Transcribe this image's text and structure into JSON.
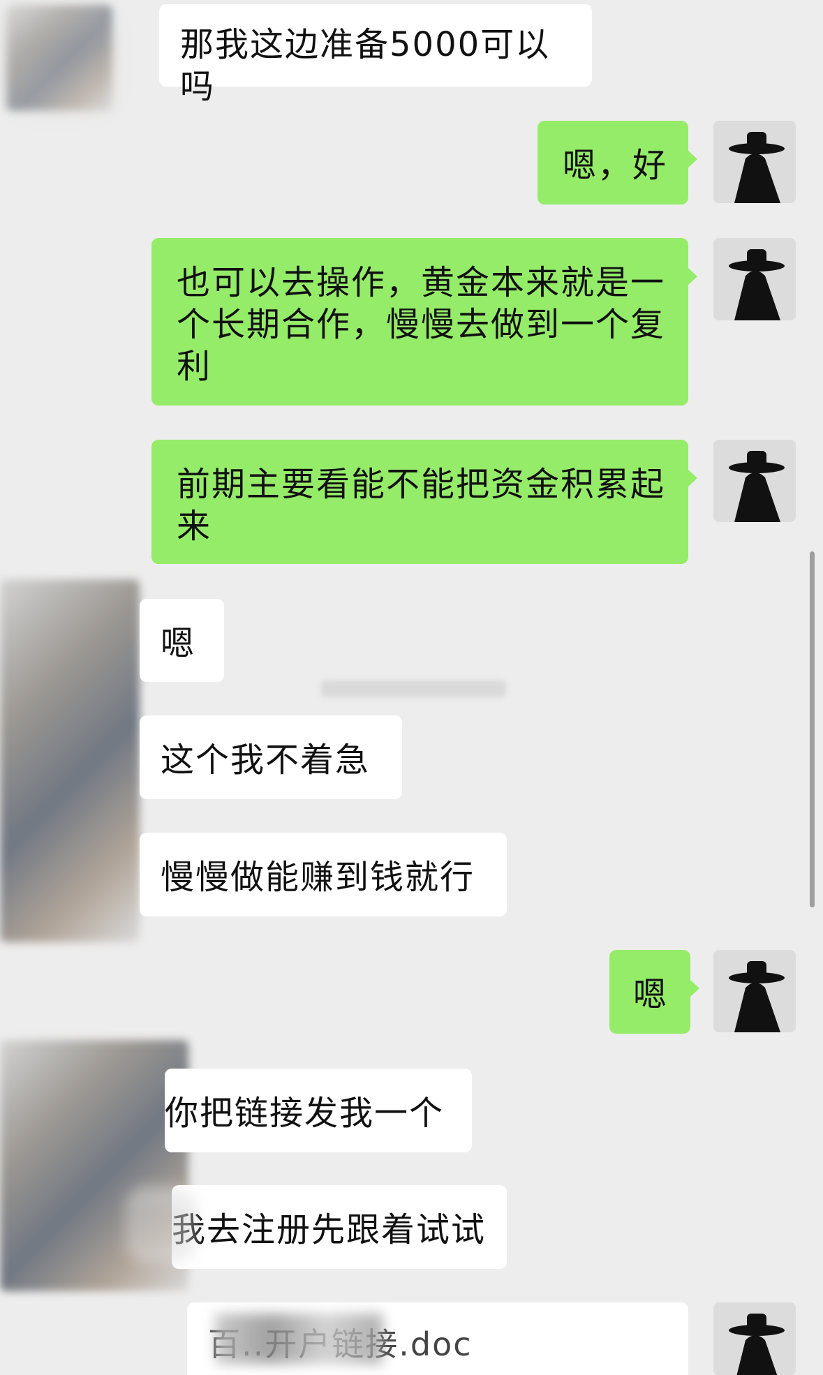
{
  "messages": [
    {
      "side": "in",
      "text": "那我这边准备5000可以吗"
    },
    {
      "side": "out",
      "text": "嗯，好"
    },
    {
      "side": "out",
      "text": "也可以去操作，黄金本来就是一个长期合作，慢慢去做到一个复利"
    },
    {
      "side": "out",
      "text": "前期主要看能不能把资金积累起来"
    },
    {
      "side": "in",
      "text": "嗯"
    },
    {
      "side": "in",
      "text": "这个我不着急"
    },
    {
      "side": "in",
      "text": "慢慢做能赚到钱就行"
    },
    {
      "side": "out",
      "text": "嗯"
    },
    {
      "side": "in",
      "text": "你把链接发我一个"
    },
    {
      "side": "in",
      "text": "我去注册先跟着试试"
    }
  ],
  "document": {
    "filename": "百..开户链接.doc"
  }
}
